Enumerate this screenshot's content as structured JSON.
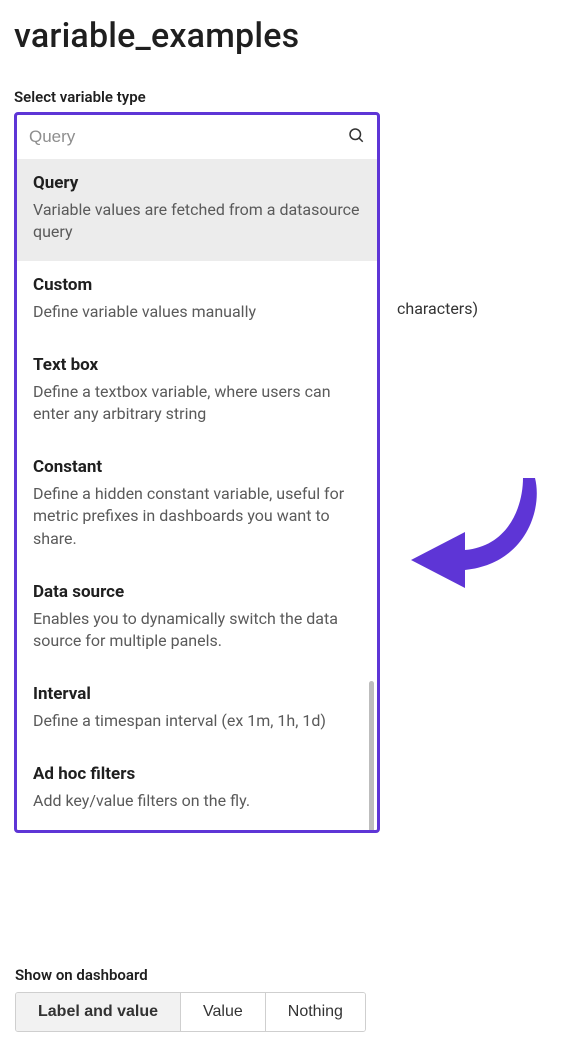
{
  "page_title": "variable_examples",
  "field_label": "Select variable type",
  "search": {
    "placeholder": "Query",
    "value": ""
  },
  "bg_text": "characters)",
  "options": [
    {
      "title": "Query",
      "desc": "Variable values are fetched from a datasource query",
      "selected": true
    },
    {
      "title": "Custom",
      "desc": "Define variable values manually"
    },
    {
      "title": "Text box",
      "desc": "Define a textbox variable, where users can enter any arbitrary string"
    },
    {
      "title": "Constant",
      "desc": "Define a hidden constant variable, useful for metric prefixes in dashboards you want to share."
    },
    {
      "title": "Data source",
      "desc": "Enables you to dynamically switch the data source for multiple panels."
    },
    {
      "title": "Interval",
      "desc": "Define a timespan interval (ex 1m, 1h, 1d)"
    },
    {
      "title": "Ad hoc filters",
      "desc": "Add key/value filters on the fly."
    }
  ],
  "show_on_dashboard": {
    "label": "Show on dashboard",
    "options": [
      "Label and value",
      "Value",
      "Nothing"
    ],
    "active_index": 0
  },
  "annotation": {
    "highlight_color": "#5e35d6"
  }
}
